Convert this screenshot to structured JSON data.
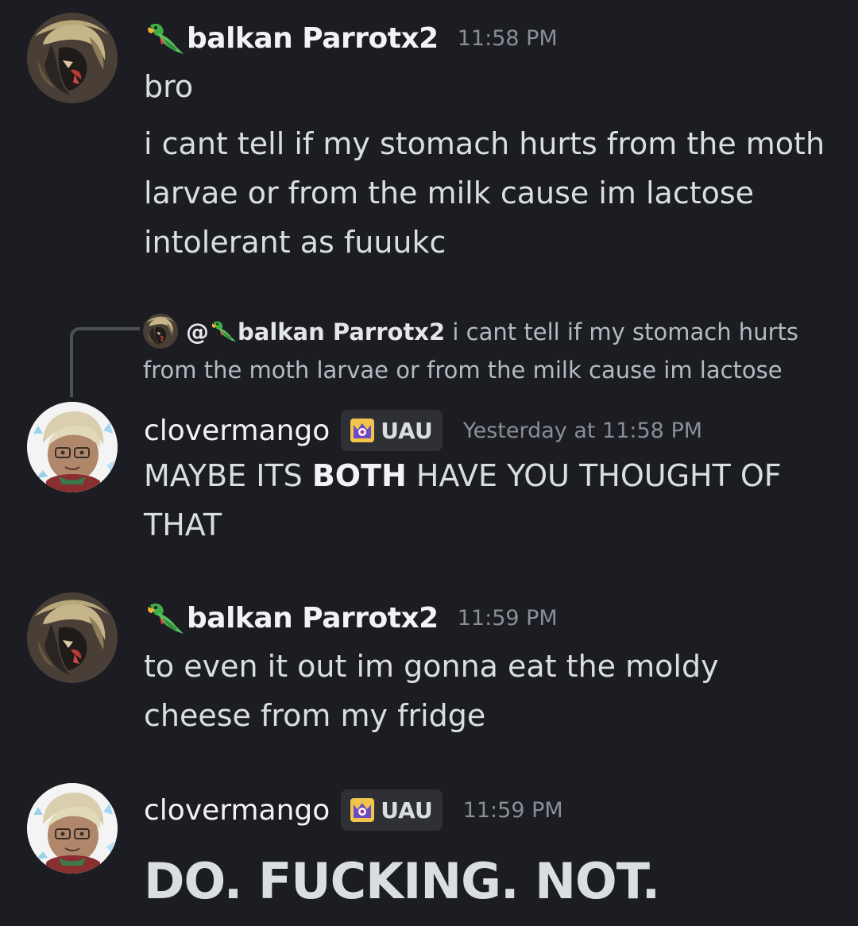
{
  "messages": [
    {
      "author": "balkan Parrotx2",
      "author_emoji": "parrot-icon",
      "time": "11:58 PM",
      "lines": [
        "bro",
        "i cant tell if my stomach hurts from the moth larvae or from the milk cause im lactose intolerant as fuuukc"
      ]
    },
    {
      "reply": {
        "mention": "@",
        "author": "balkan Parrotx2",
        "text": "i cant tell if my stomach hurts from the moth larvae or from the milk cause im lactose"
      },
      "author": "clovermango",
      "tag": "UAU",
      "tag_icon": "crown-badge-icon",
      "time": "Yesterday at 11:58 PM",
      "text_before": "MAYBE ITS ",
      "text_bold": "BOTH",
      "text_after": " HAVE YOU THOUGHT OF THAT"
    },
    {
      "author": "balkan Parrotx2",
      "author_emoji": "parrot-icon",
      "time": "11:59 PM",
      "text": "to even it out im gonna eat the moldy cheese from my fridge"
    },
    {
      "author": "clovermango",
      "tag": "UAU",
      "tag_icon": "crown-badge-icon",
      "time": "11:59 PM",
      "text": "DO. FUCKING. NOT."
    }
  ],
  "colors": {
    "background": "#1c1d22",
    "text": "#dbdee1",
    "timestamp": "#8b8e96",
    "tag_bg": "#2e3036"
  }
}
